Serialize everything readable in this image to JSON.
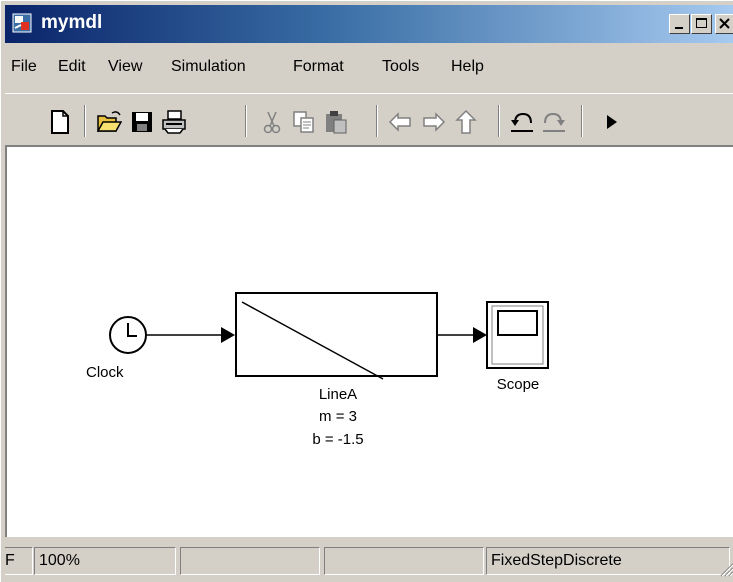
{
  "window": {
    "title": "mymdl",
    "buttons": [
      "minimize",
      "maximize",
      "close"
    ]
  },
  "menubar": {
    "items": [
      "File",
      "Edit",
      "View",
      "Simulation",
      "Format",
      "Tools",
      "Help"
    ]
  },
  "toolbar": {
    "icons": [
      "new-file-icon",
      "open-folder-icon",
      "save-icon",
      "print-icon",
      "cut-icon",
      "copy-icon",
      "paste-icon",
      "back-arrow-icon",
      "forward-arrow-icon",
      "up-arrow-icon",
      "undo-icon",
      "redo-icon",
      "start-simulation-icon"
    ]
  },
  "diagram": {
    "blocks": {
      "clock": {
        "label": "Clock"
      },
      "linea": {
        "label": "LineA",
        "param_m": "m = 3",
        "param_b": "b = -1.5"
      },
      "scope": {
        "label": "Scope"
      }
    },
    "line_color": "#000000"
  },
  "statusbar": {
    "left_cut": "F",
    "zoom": "100%",
    "pane2": "",
    "pane3": "",
    "solver": "FixedStepDiscrete"
  },
  "colors": {
    "face": "#d4d0c8",
    "title_active": "#0a246a",
    "canvas": "#ffffff"
  }
}
